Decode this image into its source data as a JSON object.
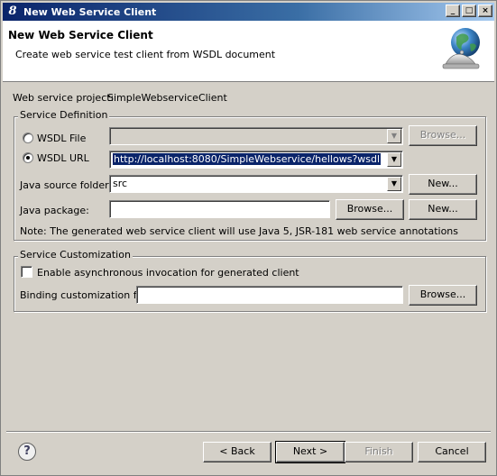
{
  "window": {
    "title": "New Web Service Client",
    "controls": {
      "minimize": "_",
      "maximize": "□",
      "close": "×"
    }
  },
  "banner": {
    "heading": "New Web Service Client",
    "description": "Create web service test client from WSDL document",
    "icon": "globe-with-bell-icon"
  },
  "project": {
    "label": "Web service project:",
    "value": "SimpleWebserviceClient"
  },
  "service_definition": {
    "group_title": "Service Definition",
    "wsdl_file": {
      "label": "WSDL File",
      "selected": false,
      "value": "",
      "browse_label": "Browse..."
    },
    "wsdl_url": {
      "label": "WSDL URL",
      "selected": true,
      "value": "http://localhost:8080/SimpleWebservice/hellows?wsdl"
    },
    "source_folder": {
      "label": "Java source folder:",
      "value": "src",
      "new_label": "New..."
    },
    "java_package": {
      "label": "Java package:",
      "value": "",
      "browse_label": "Browse...",
      "new_label": "New..."
    },
    "note": "Note: The generated web service client will use Java 5, JSR-181 web service annotations"
  },
  "service_customization": {
    "group_title": "Service Customization",
    "async_checkbox": {
      "label": "Enable asynchronous invocation for generated client",
      "checked": false
    },
    "binding_file": {
      "label": "Binding customization file:",
      "value": "",
      "browse_label": "Browse..."
    }
  },
  "footer": {
    "help_glyph": "?",
    "back_label": "< Back",
    "next_label": "Next >",
    "finish_label": "Finish",
    "cancel_label": "Cancel"
  }
}
